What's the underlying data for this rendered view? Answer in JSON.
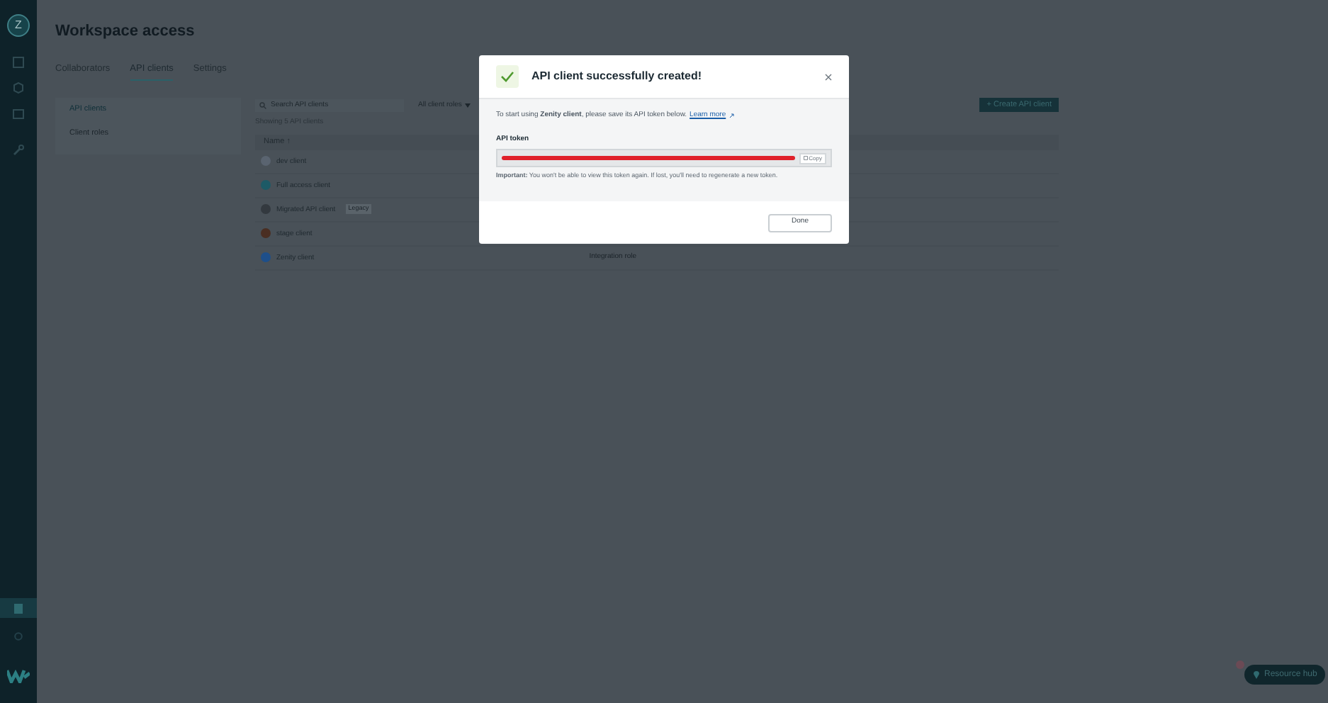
{
  "page": {
    "title": "Workspace access"
  },
  "tabs": [
    {
      "label": "Collaborators",
      "selected": false
    },
    {
      "label": "API clients",
      "selected": true
    },
    {
      "label": "Settings",
      "selected": false
    }
  ],
  "side_nav": [
    {
      "label": "API clients",
      "selected": true
    },
    {
      "label": "Client roles",
      "selected": false
    }
  ],
  "search": {
    "placeholder": "Search API clients"
  },
  "role_filter": {
    "value": "All client roles"
  },
  "create_button": "+ Create API client",
  "count": "Showing 5 API clients",
  "table": {
    "columns": [
      "Name ↑"
    ],
    "rows": [
      {
        "name": "dev client",
        "color": "#5a6470"
      },
      {
        "name": "Full access client",
        "color": "#1d5a66"
      },
      {
        "name": "Migrated API client",
        "badge": "Legacy",
        "color": "#33393f"
      },
      {
        "name": "stage client",
        "color": "#4a2e22"
      },
      {
        "name": "Zenity client",
        "role": "Integration role",
        "color": "#1e4f8a"
      }
    ]
  },
  "avatar_letter": "Z",
  "resource_hub": "Resource hub",
  "dialog": {
    "title": "API client successfully created!",
    "intro": "To start using **Zenity client**, please save its API token below.",
    "link": "Learn more",
    "token_label": "API token",
    "token_redacted": true,
    "copy": "Copy",
    "note": "**Important:** You won't be able to view this token again. If lost, you'll need to regenerate a new token.",
    "done": "Done"
  }
}
